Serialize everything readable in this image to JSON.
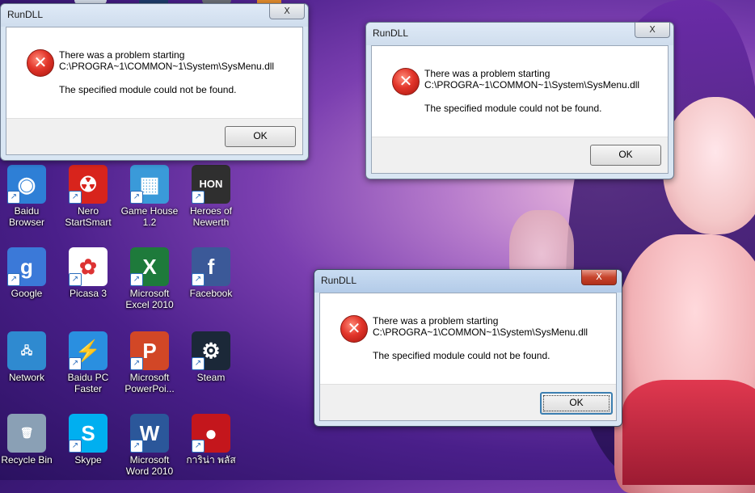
{
  "dialogs": [
    {
      "title": "RunDLL",
      "message_line1": "There was a problem starting",
      "message_line2": "C:\\PROGRA~1\\COMMON~1\\System\\SysMenu.dll",
      "message_detail": "The specified module could not be found.",
      "ok_label": "OK",
      "close_label": "X",
      "active": false
    },
    {
      "title": "RunDLL",
      "message_line1": "There was a problem starting",
      "message_line2": "C:\\PROGRA~1\\COMMON~1\\System\\SysMenu.dll",
      "message_detail": "The specified module could not be found.",
      "ok_label": "OK",
      "close_label": "X",
      "active": false
    },
    {
      "title": "RunDLL",
      "message_line1": "There was a problem starting",
      "message_line2": "C:\\PROGRA~1\\COMMON~1\\System\\SysMenu.dll",
      "message_detail": "The specified module could not be found.",
      "ok_label": "OK",
      "close_label": "X",
      "active": true
    }
  ],
  "desktop_icons": [
    {
      "label": "Baidu Browser",
      "icon": "baidu-browser-icon",
      "color": "#2e7fd6",
      "glyph": "◉"
    },
    {
      "label": "Nero StartSmart",
      "icon": "nero-icon",
      "color": "#d8241c",
      "glyph": "☢"
    },
    {
      "label": "Game House 1.2",
      "icon": "game-house-icon",
      "color": "#3a9ad9",
      "glyph": "▦"
    },
    {
      "label": "Heroes of Newerth",
      "icon": "hon-icon",
      "color": "#2f2f2f",
      "glyph": "HON"
    },
    {
      "label": "Google",
      "icon": "google-icon",
      "color": "#3b79d8",
      "glyph": "g"
    },
    {
      "label": "Picasa 3",
      "icon": "picasa-icon",
      "color": "#ffffff",
      "glyph": "✿"
    },
    {
      "label": "Microsoft Excel 2010",
      "icon": "excel-icon",
      "color": "#1e7a3b",
      "glyph": "X"
    },
    {
      "label": "Facebook",
      "icon": "facebook-icon",
      "color": "#3b5998",
      "glyph": "f"
    },
    {
      "label": "Network",
      "icon": "network-icon",
      "color": "#2f8ad0",
      "glyph": "🖧"
    },
    {
      "label": "Baidu PC Faster",
      "icon": "baidu-pc-faster-icon",
      "color": "#2a8fe0",
      "glyph": "⚡"
    },
    {
      "label": "Microsoft PowerPoi...",
      "icon": "powerpoint-icon",
      "color": "#d24726",
      "glyph": "P"
    },
    {
      "label": "Steam",
      "icon": "steam-icon",
      "color": "#1b2838",
      "glyph": "⚙"
    },
    {
      "label": "Recycle Bin",
      "icon": "recycle-bin-icon",
      "color": "#8aa0b5",
      "glyph": "🗑"
    },
    {
      "label": "Skype",
      "icon": "skype-icon",
      "color": "#00aff0",
      "glyph": "S"
    },
    {
      "label": "Microsoft Word 2010",
      "icon": "word-icon",
      "color": "#2b579a",
      "glyph": "W"
    },
    {
      "label": "การิน่า พลัส",
      "icon": "garena-plus-icon",
      "color": "#c4161c",
      "glyph": "●"
    }
  ],
  "shortcut_arrow": "↗",
  "error_glyph": "✕"
}
